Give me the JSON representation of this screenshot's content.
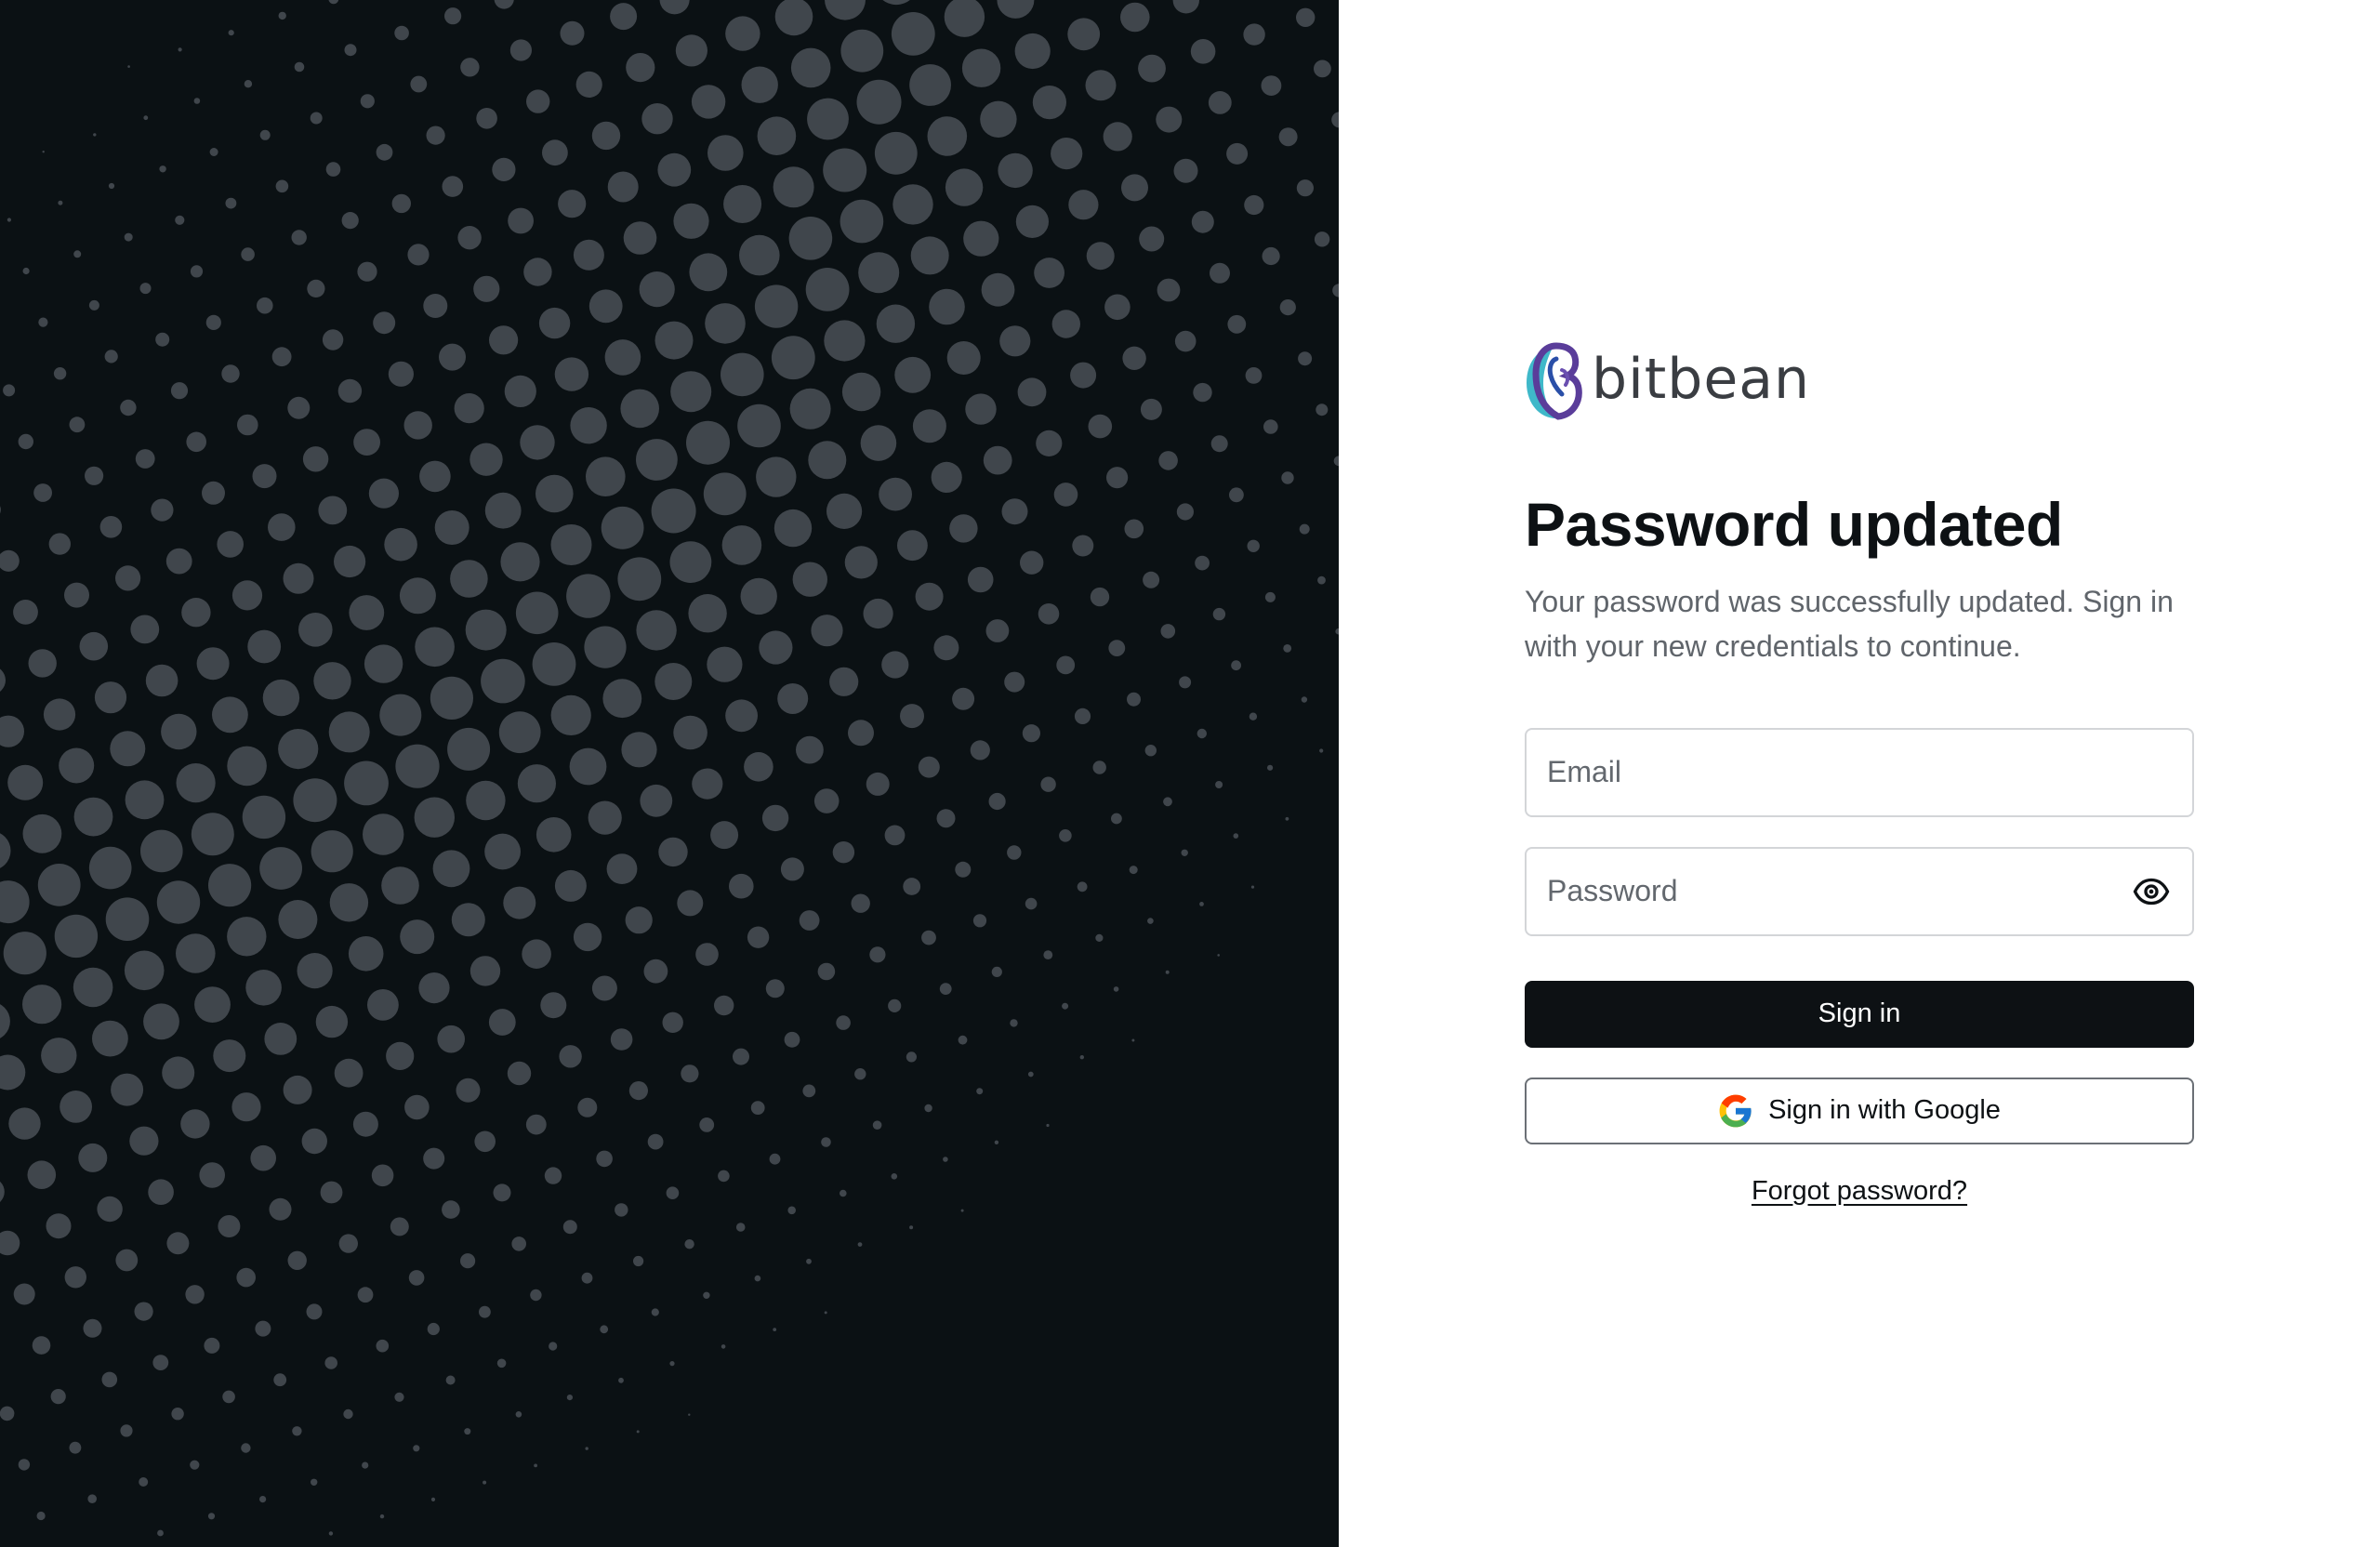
{
  "brand": {
    "name": "bitbean",
    "logo_icon": "bitbean-logo-icon",
    "colors": [
      "#3fb8c9",
      "#5a3d9a",
      "#2a4fa8"
    ]
  },
  "hero": {
    "background_color": "#0b1114",
    "dot_color": "#40464c",
    "pattern": "halftone-dots"
  },
  "auth": {
    "title": "Password updated",
    "subtitle": "Your password was successfully updated. Sign in with your new credentials to continue.",
    "email": {
      "value": "",
      "placeholder": "Email"
    },
    "password": {
      "value": "",
      "placeholder": "Password",
      "toggle_icon": "eye-icon"
    },
    "sign_in_label": "Sign in",
    "google_label": "Sign in with Google",
    "google_icon": "google-g-icon",
    "forgot_label": "Forgot password?"
  },
  "colors": {
    "primary_button": "#0d1114",
    "text": "#0d1114",
    "muted_text": "#60656b",
    "input_border": "#d3d5d8"
  }
}
